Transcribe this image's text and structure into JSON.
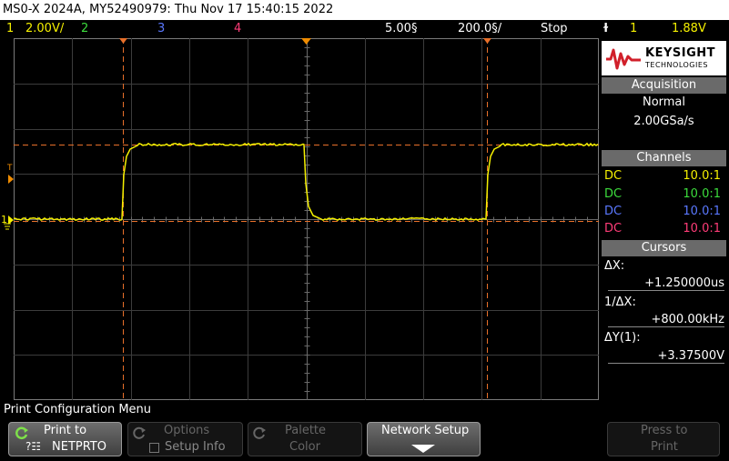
{
  "title_bar": {
    "text": "MS0-X 2024A, MY52490979: Thu Nov 17 15:40:15 2022"
  },
  "status": {
    "ch1_num": "1",
    "ch1_scale": "2.00V/",
    "ch2_num": "2",
    "ch3_num": "3",
    "ch4_num": "4",
    "time_pos": "5.00§",
    "time_scale": "200.0§/",
    "run_state": "Stop",
    "trigger_icon": "trigger-edge-icon",
    "trigger_ch": "1",
    "trigger_level": "1.88V"
  },
  "colors": {
    "ch1": "#f5f000",
    "ch2": "#3cdc3c",
    "ch3": "#5a78ff",
    "ch4": "#ff3c78",
    "cursor": "#e8702a",
    "trigger_marker": "#f08c00"
  },
  "markers": {
    "trigger_label": "T",
    "ground_label": "1"
  },
  "brand": {
    "name": "KEYSIGHT",
    "sub": "TECHNOLOGIES"
  },
  "acquisition": {
    "header": "Acquisition",
    "mode": "Normal",
    "rate": "2.00GSa/s"
  },
  "channels": {
    "header": "Channels",
    "rows": [
      {
        "coupling": "DC",
        "ratio": "10.0:1"
      },
      {
        "coupling": "DC",
        "ratio": "10.0:1"
      },
      {
        "coupling": "DC",
        "ratio": "10.0:1"
      },
      {
        "coupling": "DC",
        "ratio": "10.0:1"
      }
    ]
  },
  "cursors": {
    "header": "Cursors",
    "dx_label": "ΔX:",
    "dx_value": "+1.250000us",
    "inv_label": "1/ΔX:",
    "inv_value": "+800.00kHz",
    "dy_label": "ΔY(1):",
    "dy_value": "+3.37500V"
  },
  "menu": {
    "title": "Print Configuration Menu",
    "print_to_label": "Print to",
    "print_to_value": "NETPRTO",
    "options_label": "Options",
    "setup_info_label": "Setup Info",
    "palette_label": "Palette",
    "palette_value": "Color",
    "network_setup_label": "Network Setup",
    "press_to_label": "Press to",
    "print_label": "Print"
  }
}
